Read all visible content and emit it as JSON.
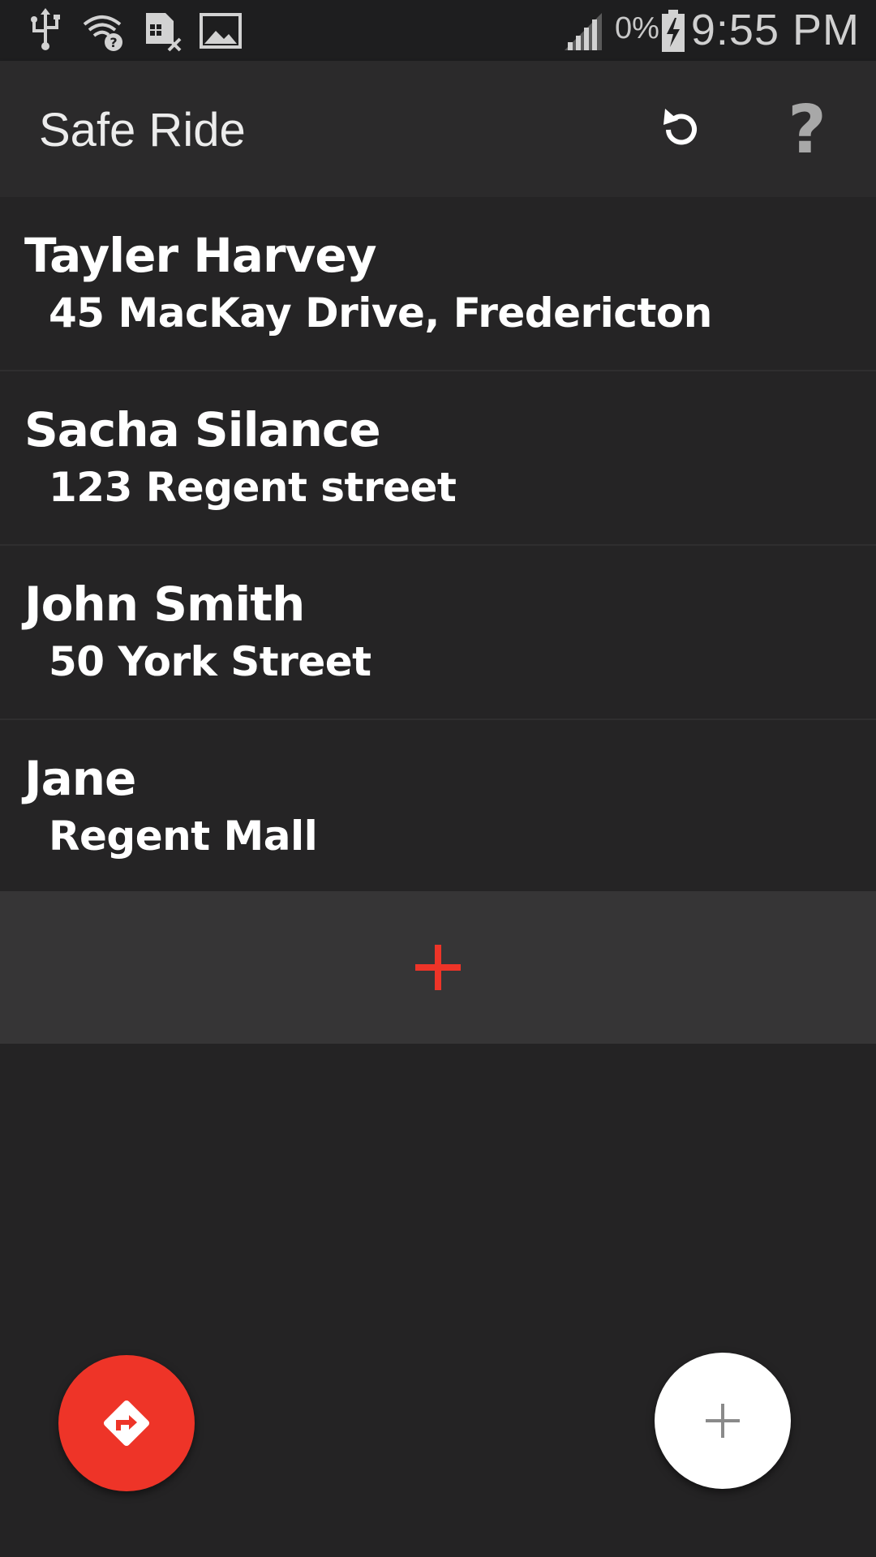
{
  "status_bar": {
    "icons": [
      "usb-icon",
      "wifi-unknown-icon",
      "sim-error-icon",
      "image-icon",
      "signal-icon",
      "battery-charging-icon"
    ],
    "battery_percent": "0%",
    "time": "9:55 PM"
  },
  "app_bar": {
    "title": "Safe Ride",
    "actions": [
      "refresh-icon",
      "help-icon"
    ]
  },
  "rides": [
    {
      "name": "Tayler Harvey",
      "address": "45 MacKay Drive, Fredericton"
    },
    {
      "name": "Sacha Silance",
      "address": "123 Regent street"
    },
    {
      "name": "John Smith",
      "address": "50 York Street"
    },
    {
      "name": "Jane",
      "address": "Regent Mall"
    }
  ],
  "add_row": {
    "icon": "plus-icon"
  },
  "fabs": {
    "directions_icon": "directions-icon",
    "add_icon": "plus-icon"
  },
  "colors": {
    "accent": "#ee3428",
    "background": "#242324",
    "app_bar": "#2b2a2b",
    "add_row": "#363536"
  }
}
